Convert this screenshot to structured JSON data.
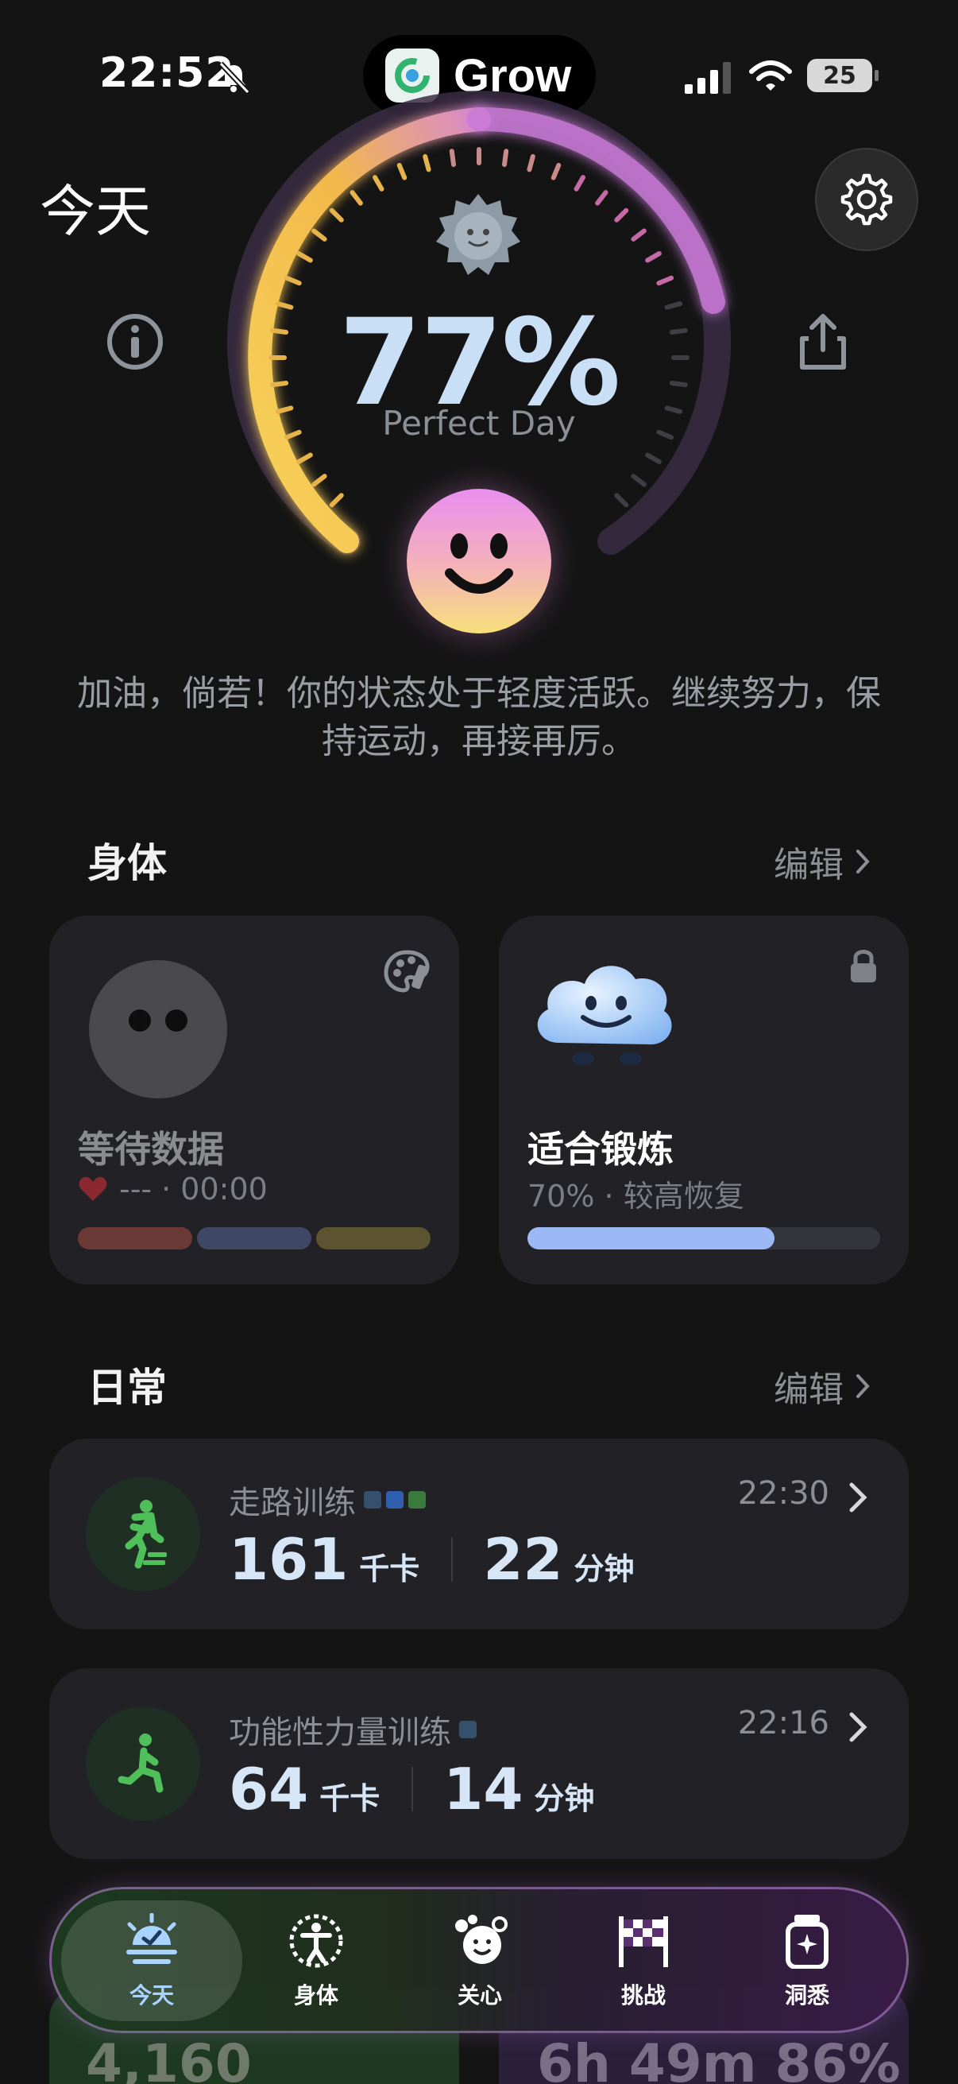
{
  "status_bar": {
    "time": "22:52",
    "app_name": "Grow",
    "battery": "25"
  },
  "header": {
    "title": "今天"
  },
  "score": {
    "percent": "77%",
    "label": "Perfect Day",
    "value": 0.77
  },
  "motto": "加油，倘若！你的状态处于轻度活跃。继续努力，保持运动，再接再厉。",
  "body_section": {
    "title": "身体",
    "edit_label": "编辑",
    "cards": [
      {
        "title": "等待数据",
        "sub_dashes": "---",
        "sub_time": "· 00:00"
      },
      {
        "title": "适合锻炼",
        "sub": "70% · 较高恢复",
        "progress": 0.7
      }
    ]
  },
  "daily_section": {
    "title": "日常",
    "edit_label": "编辑",
    "activities": [
      {
        "name": "走路训练",
        "time": "22:30",
        "kcal": "161",
        "kcal_unit": "千卡",
        "minutes": "22",
        "min_unit": "分钟"
      },
      {
        "name": "功能性力量训练",
        "time": "22:16",
        "kcal": "64",
        "kcal_unit": "千卡",
        "minutes": "14",
        "min_unit": "分钟"
      }
    ]
  },
  "peek": {
    "left": "4,160",
    "right": "6h 49m 86%"
  },
  "tabs": [
    {
      "label": "今天",
      "icon": "sun-icon",
      "active": true
    },
    {
      "label": "身体",
      "icon": "body-icon"
    },
    {
      "label": "关心",
      "icon": "care-icon"
    },
    {
      "label": "挑战",
      "icon": "flag-icon"
    },
    {
      "label": "洞悉",
      "icon": "jar-icon"
    }
  ],
  "colors": {
    "accent_blue": "#9cb8f5",
    "stat_text": "#d6e6f6",
    "green_icon": "#4fbf5a"
  }
}
